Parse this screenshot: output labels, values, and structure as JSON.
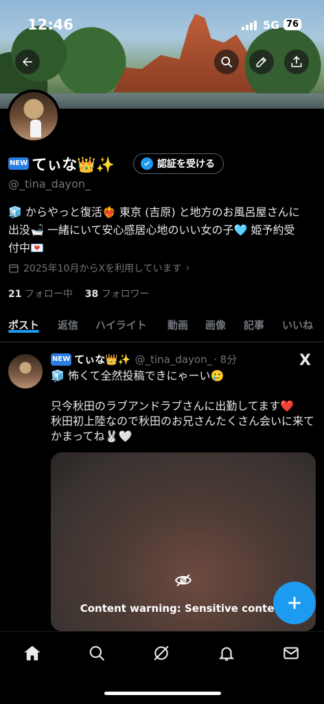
{
  "status_bar": {
    "time": "12:46",
    "network": "5G",
    "battery": "76"
  },
  "profile": {
    "new_badge": "NEW",
    "display_name": "てぃな👑✨",
    "verify_label": "認証を受ける",
    "handle": "@_tina_dayon_",
    "bio_line1": "🧊 からやっと復活❤️‍🔥 東京 (吉原) と地方のお風呂屋さんに",
    "bio_line2": "出没🛁 一緒にいて安心感居心地のいい女の子🩵 姫予約受",
    "bio_line3": "付中💌",
    "joined": "2025年10月からXを利用しています",
    "following_count": "21",
    "following_label": "フォロー中",
    "followers_count": "38",
    "followers_label": "フォロワー"
  },
  "tabs": [
    "ポスト",
    "返信",
    "ハイライト",
    "動画",
    "画像",
    "記事",
    "いいね"
  ],
  "post": {
    "new_badge": "NEW",
    "author_name": "てぃな👑✨",
    "author_handle": "@_tina_dayon_",
    "time": "· 8分",
    "text": "🧊 怖くて全然投稿できにゃーい🥲\n\n只今秋田のラブアンドラブさんに出勤してます❤️\n秋田初上陸なので秋田のお兄さんたくさん会いに来てかまってね🐰🤍",
    "x_mark": "X",
    "content_warning": "Content warning: Sensitive content"
  },
  "colors": {
    "accent": "#1d9bf0",
    "background": "#000000",
    "muted": "#71767b"
  }
}
